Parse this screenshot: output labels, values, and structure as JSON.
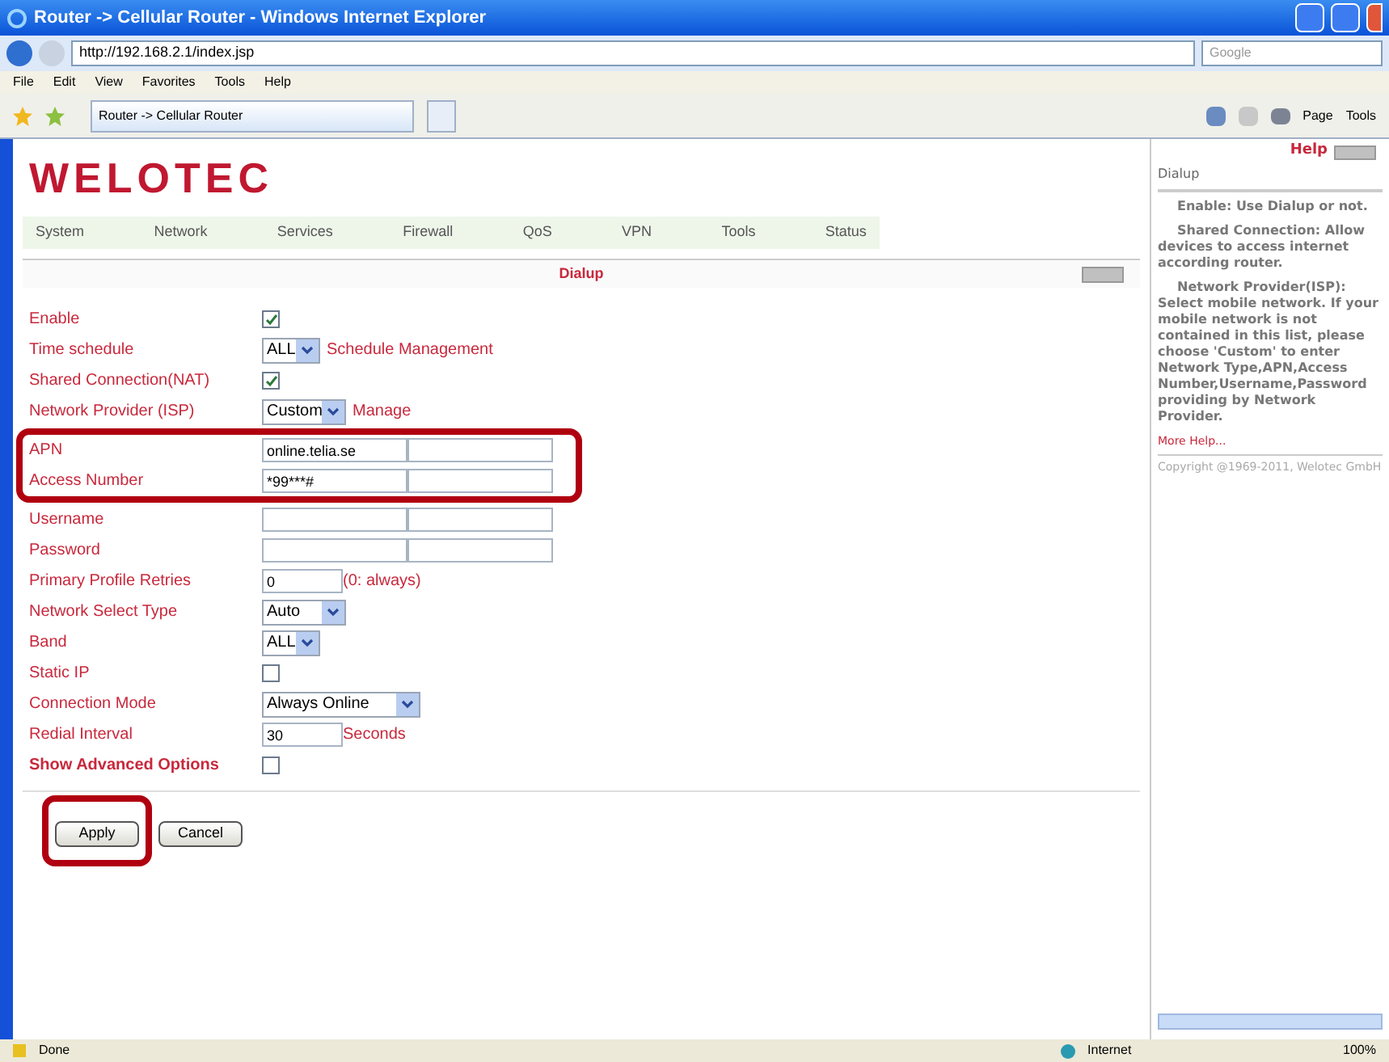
{
  "window": {
    "title": "Router -> Cellular Router - Windows Internet Explorer"
  },
  "address_bar": {
    "url": "http://192.168.2.1/index.jsp",
    "search_placeholder": "Google"
  },
  "menu": [
    "File",
    "Edit",
    "View",
    "Favorites",
    "Tools",
    "Help"
  ],
  "tab": {
    "title": "Router -> Cellular Router"
  },
  "command_bar": [
    "Page",
    "Tools"
  ],
  "logo": "WELOTEC",
  "nav": [
    "System",
    "Network",
    "Services",
    "Firewall",
    "QoS",
    "VPN",
    "Tools",
    "Status"
  ],
  "panel": {
    "title": "Dialup"
  },
  "rows": [
    {
      "label": "Enable",
      "kind": "checkbox",
      "checked": true,
      "highlighted": false
    },
    {
      "label": "Time schedule",
      "kind": "select",
      "value": "ALL",
      "link": "Schedule Management",
      "highlighted": false
    },
    {
      "label": "Shared Connection(NAT)",
      "kind": "checkbox",
      "checked": true,
      "highlighted": false
    },
    {
      "label": "Network Provider (ISP)",
      "kind": "select",
      "value": "Custom",
      "link": "Manage",
      "highlighted": false
    },
    {
      "label": "APN",
      "kind": "pair",
      "value": "online.telia.se",
      "highlighted": true
    },
    {
      "label": "Access Number",
      "kind": "pair",
      "value": "*99***#",
      "highlighted": true
    },
    {
      "label": "Username",
      "kind": "pair",
      "highlighted": false
    },
    {
      "label": "Password",
      "kind": "pair",
      "highlighted": false
    },
    {
      "label": "Primary Profile Retries",
      "kind": "text",
      "value": "0",
      "suffix": "(0: always)",
      "highlighted": false
    },
    {
      "label": "Network Select Type",
      "kind": "select",
      "value": "Auto",
      "highlighted": false
    },
    {
      "label": "Band",
      "kind": "select",
      "value": "ALL",
      "highlighted": false
    },
    {
      "label": "Static IP",
      "kind": "checkbox",
      "checked": false,
      "highlighted": false
    },
    {
      "label": "Connection Mode",
      "kind": "select",
      "value": "Always Online",
      "highlighted": false
    },
    {
      "label": "Redial Interval",
      "kind": "text",
      "value": "30",
      "suffix": "Seconds",
      "highlighted": false
    },
    {
      "label": "Show Advanced Options",
      "kind": "checkbox",
      "checked": false,
      "bold": true,
      "highlighted": false
    }
  ],
  "buttons": [
    {
      "label": "Apply",
      "highlighted": true
    },
    {
      "label": "Cancel",
      "highlighted": false
    }
  ],
  "help": {
    "title": "Help",
    "section": "Dialup",
    "paragraphs": [
      "Enable: Use Dialup or not.",
      "Shared Connection: Allow devices to access internet according router.",
      "Network Provider(ISP): Select mobile network. If your mobile network is not contained in this list, please choose 'Custom' to enter Network Type,APN,Access Number,Username,Password providing by Network Provider."
    ],
    "more": "More Help...",
    "copyright": "Copyright @1969-2011, Welotec GmbH"
  },
  "status_bar": {
    "text": "Done",
    "zone": "Internet",
    "zoom": "100%"
  }
}
